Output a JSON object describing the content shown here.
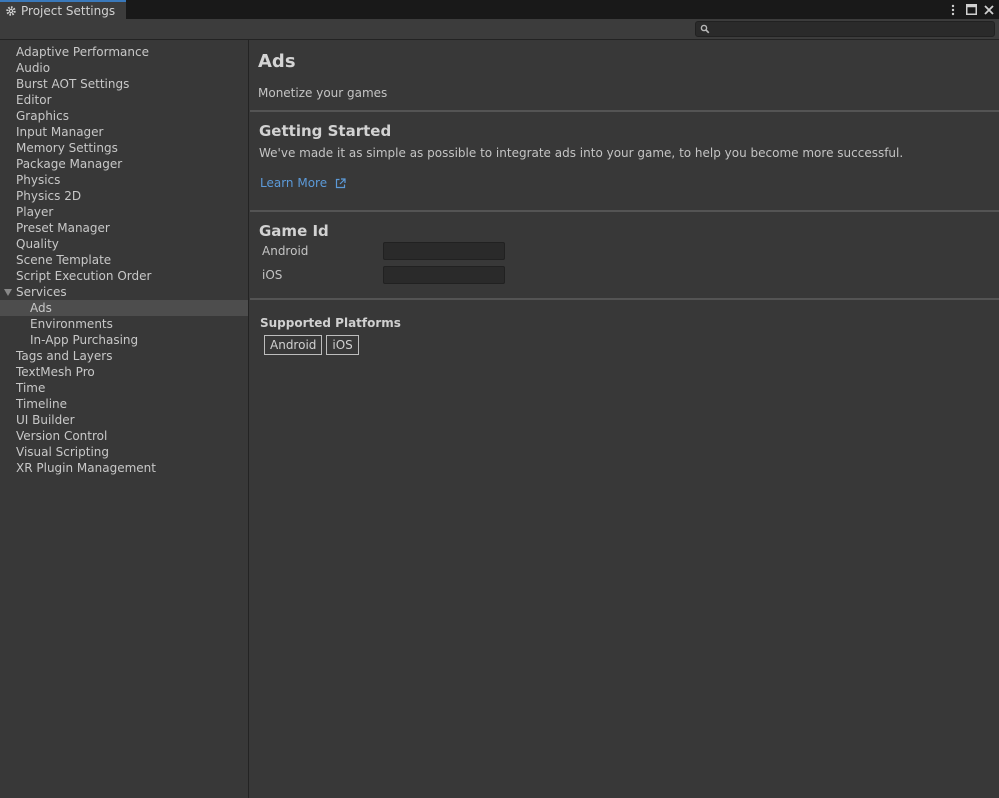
{
  "window": {
    "title": "Project Settings",
    "controls": [
      "more-icon",
      "maximize-icon",
      "close-icon"
    ]
  },
  "search": {
    "placeholder": "",
    "value": ""
  },
  "sidebar": {
    "items": [
      {
        "label": "Adaptive Performance"
      },
      {
        "label": "Audio"
      },
      {
        "label": "Burst AOT Settings"
      },
      {
        "label": "Editor"
      },
      {
        "label": "Graphics"
      },
      {
        "label": "Input Manager"
      },
      {
        "label": "Memory Settings"
      },
      {
        "label": "Package Manager"
      },
      {
        "label": "Physics"
      },
      {
        "label": "Physics 2D"
      },
      {
        "label": "Player"
      },
      {
        "label": "Preset Manager"
      },
      {
        "label": "Quality"
      },
      {
        "label": "Scene Template"
      },
      {
        "label": "Script Execution Order"
      },
      {
        "label": "Services",
        "expanded": true
      },
      {
        "label": "Ads",
        "child": true,
        "selected": true
      },
      {
        "label": "Environments",
        "child": true
      },
      {
        "label": "In-App Purchasing",
        "child": true
      },
      {
        "label": "Tags and Layers"
      },
      {
        "label": "TextMesh Pro"
      },
      {
        "label": "Time"
      },
      {
        "label": "Timeline"
      },
      {
        "label": "UI Builder"
      },
      {
        "label": "Version Control"
      },
      {
        "label": "Visual Scripting"
      },
      {
        "label": "XR Plugin Management"
      }
    ]
  },
  "main": {
    "title": "Ads",
    "subtitle": "Monetize your games",
    "getting_started": {
      "title": "Getting Started",
      "description": "We've made it as simple as possible to integrate ads into your game, to help you become more successful.",
      "link_label": "Learn More"
    },
    "game_id": {
      "title": "Game Id",
      "android_label": "Android",
      "android_value": "",
      "ios_label": "iOS",
      "ios_value": ""
    },
    "supported_platforms": {
      "title": "Supported Platforms",
      "platforms": [
        "Android",
        "iOS"
      ]
    }
  },
  "colors": {
    "background": "#383838",
    "link": "#5c9ad8",
    "tab_accent": "#3a79bb"
  }
}
